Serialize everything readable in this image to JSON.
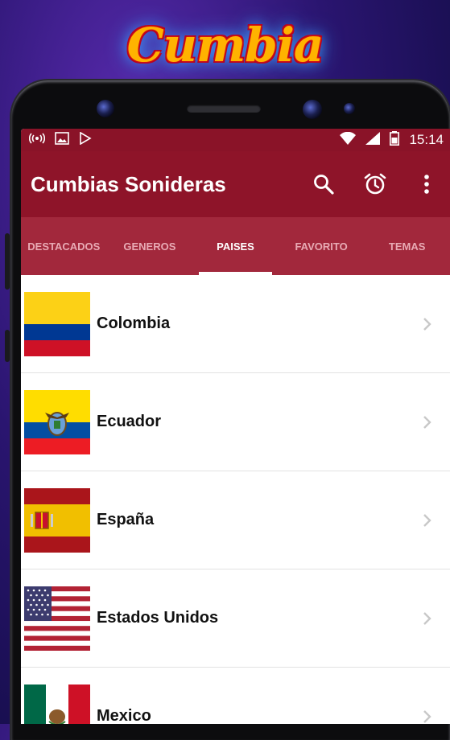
{
  "logo": {
    "text": "Cumbia"
  },
  "statusbar": {
    "time": "15:14"
  },
  "toolbar": {
    "title": "Cumbias Sonideras"
  },
  "tabs": [
    {
      "label": "DESTACADOS"
    },
    {
      "label": "GENEROS"
    },
    {
      "label": "PAISES",
      "active": true
    },
    {
      "label": "FAVORITO"
    },
    {
      "label": "TEMAS"
    }
  ],
  "countries": [
    {
      "name": "Colombia",
      "flag": "colombia-flag-icon"
    },
    {
      "name": "Ecuador",
      "flag": "ecuador-flag-icon"
    },
    {
      "name": "España",
      "flag": "spain-flag-icon"
    },
    {
      "name": "Estados Unidos",
      "flag": "usa-flag-icon"
    },
    {
      "name": "Mexico",
      "flag": "mexico-flag-icon"
    }
  ],
  "colors": {
    "toolbar": "#8e1429",
    "tabs": "#a2283c",
    "statusbar": "#8a1328"
  }
}
